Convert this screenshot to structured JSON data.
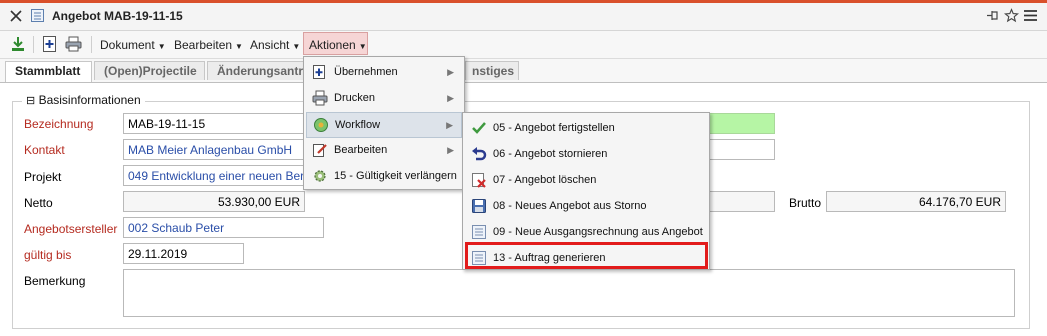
{
  "window": {
    "title": "Angebot MAB-19-11-15",
    "icons": [
      "close-icon",
      "document-icon",
      "pin-icon",
      "star-icon",
      "hamburger-menu-icon"
    ]
  },
  "toolbar": {
    "menus": [
      "Dokument",
      "Bearbeiten",
      "Ansicht",
      "Aktionen"
    ],
    "icons": [
      "download-icon",
      "new-document-icon",
      "print-icon"
    ]
  },
  "tabs": [
    "Stammblatt",
    "(Open)Projectile",
    "Änderungsantr",
    "nstiges"
  ],
  "section": {
    "collapse_symbol": "⊟",
    "title": "Basisinformationen"
  },
  "form": {
    "bezeichnung": {
      "label": "Bezeichnung",
      "value": "MAB-19-11-15"
    },
    "kontakt": {
      "label": "Kontakt",
      "value": "MAB Meier Anlagenbau GmbH"
    },
    "projekt": {
      "label": "Projekt",
      "value": "049 Entwicklung einer neuen Ber"
    },
    "netto": {
      "label": "Netto",
      "value": "53.930,00 EUR"
    },
    "brutto": {
      "label": "Brutto",
      "value": "64.176,70 EUR"
    },
    "angebotsersteller": {
      "label": "Angebotsersteller",
      "value": "002 Schaub Peter"
    },
    "gueltig_bis": {
      "label": "gültig bis",
      "value": "29.11.2019"
    },
    "bemerkung": {
      "label": "Bemerkung",
      "value": ""
    }
  },
  "aktionen_menu": [
    {
      "label": "Übernehmen",
      "icon": "add-document-icon"
    },
    {
      "label": "Drucken",
      "icon": "printer-icon"
    },
    {
      "label": "Workflow",
      "icon": "workflow-icon",
      "highlighted": true
    },
    {
      "label": "Bearbeiten",
      "icon": "edit-icon"
    },
    {
      "label": "15 - Gültigkeit verlängern",
      "icon": "gear-icon"
    }
  ],
  "workflow_menu": [
    {
      "label": "05 - Angebot fertigstellen",
      "icon": "checkmark-icon"
    },
    {
      "label": "06 - Angebot stornieren",
      "icon": "undo-icon"
    },
    {
      "label": "07 - Angebot löschen",
      "icon": "delete-icon"
    },
    {
      "label": "08 - Neues Angebot aus Storno",
      "icon": "disk-icon"
    },
    {
      "label": "09 - Neue Ausgangsrechnung aus Angebot",
      "icon": "invoice-icon"
    },
    {
      "label": "13 - Auftrag generieren",
      "icon": "order-icon",
      "emphasized": true
    }
  ],
  "colors": {
    "accent": "#d9502b",
    "required_label": "#b52b20",
    "link_value": "#2a4ea8",
    "highlight_box": "#e21b1b",
    "bezeichnung_fill": "#b6f5a5"
  }
}
